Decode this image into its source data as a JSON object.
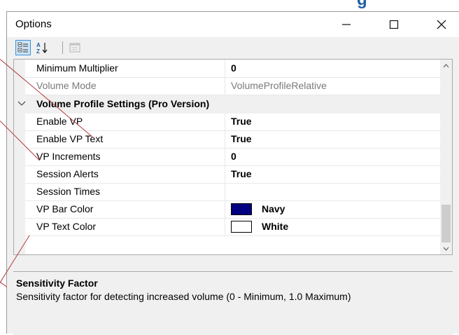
{
  "background": {
    "partial_heading": "g"
  },
  "window": {
    "title": "Options",
    "controls": {
      "minimize": "minimize-icon",
      "maximize": "maximize-icon",
      "close": "close-icon"
    }
  },
  "toolbar": {
    "buttons": [
      {
        "icon": "categorized-icon",
        "active": true
      },
      {
        "icon": "sort-alphabetical-icon",
        "active": false
      },
      {
        "icon": "property-pages-icon",
        "active": false,
        "disabled": true
      }
    ]
  },
  "grid": {
    "rows_top": [
      {
        "name": "Minimum Multiplier",
        "value": "0",
        "bold": true,
        "readonly": false
      },
      {
        "name": "Volume Mode",
        "value": "VolumeProfileRelative",
        "bold": false,
        "readonly": true
      }
    ],
    "category": {
      "label": "Volume Profile Settings (Pro Version)",
      "expanded": true
    },
    "rows": [
      {
        "name": "Enable VP",
        "value": "True"
      },
      {
        "name": "Enable VP Text",
        "value": "True"
      },
      {
        "name": "VP Increments",
        "value": "0"
      },
      {
        "name": "Session Alerts",
        "value": "True"
      },
      {
        "name": "Session Times",
        "value": ""
      },
      {
        "name": "VP Bar Color",
        "value": "Navy",
        "swatch": "#000080"
      },
      {
        "name": "VP Text Color",
        "value": "White",
        "swatch": "#ffffff"
      }
    ]
  },
  "description": {
    "title": "Sensitivity Factor",
    "text": "Sensitivity factor for detecting increased volume (0 - Minimum, 1.0 Maximum)"
  },
  "colors": {
    "annotation_line": "#b23a3a",
    "heading": "#1f5fa8",
    "swatch_navy": "#000080"
  }
}
